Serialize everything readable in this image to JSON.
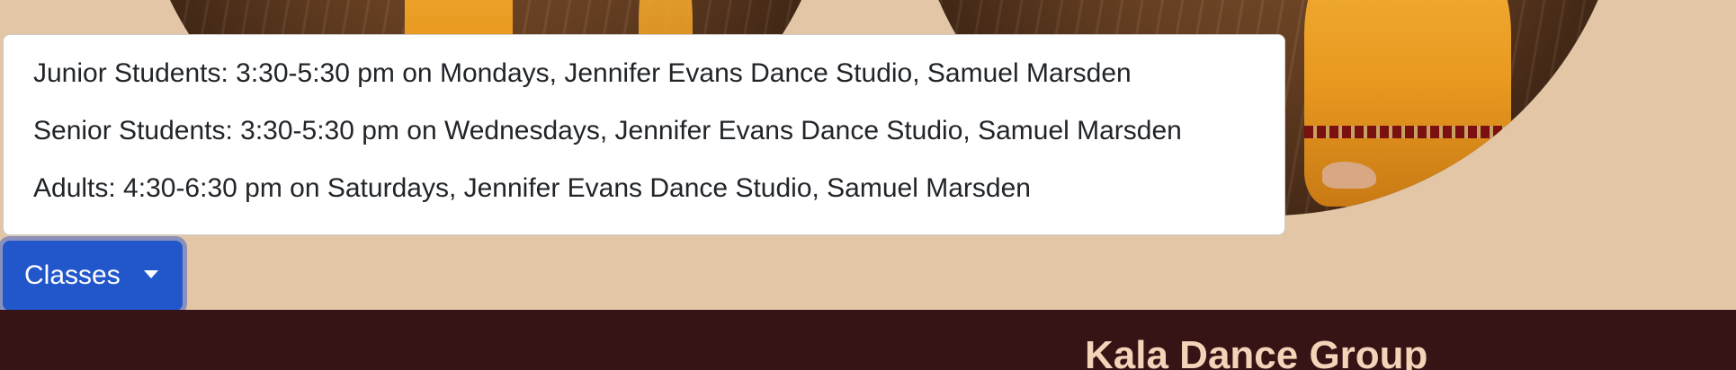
{
  "classes_dropdown": {
    "toggle_label": "Classes",
    "items": [
      {
        "text": "Junior Students: 3:30-5:30 pm on Mondays, Jennifer Evans Dance Studio, Samuel Marsden"
      },
      {
        "text": "Senior Students: 3:30-5:30 pm on Wednesdays, Jennifer Evans Dance Studio, Samuel Marsden"
      },
      {
        "text": "Adults: 4:30-6:30 pm on Saturdays, Jennifer Evans Dance Studio, Samuel Marsden"
      }
    ]
  },
  "footer": {
    "title": "Kala Dance Group"
  },
  "colors": {
    "page_background": "#e2c6a6",
    "button_primary": "#2256cb",
    "footer_background": "#361315",
    "footer_title": "#f3d4b8"
  },
  "icons": {
    "dropdown_caret": "chevron-down-icon"
  }
}
